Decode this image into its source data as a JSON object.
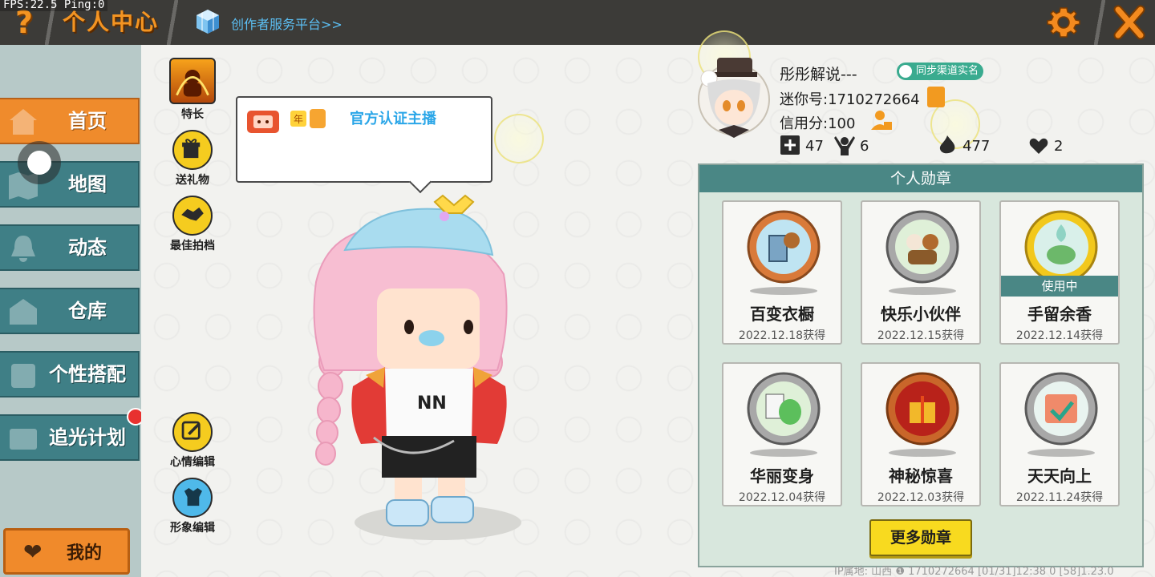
{
  "topbar": {
    "fps": "FPS:22.5  Ping:0",
    "help_label": "?",
    "title": "个人中心",
    "creator_link": "创作者服务平台>>"
  },
  "sidebar": {
    "items": [
      {
        "label": "首页",
        "icon": "home-icon",
        "active": true
      },
      {
        "label": "地图",
        "icon": "map-icon",
        "active": false
      },
      {
        "label": "动态",
        "icon": "bell-icon",
        "active": false
      },
      {
        "label": "仓库",
        "icon": "warehouse-icon",
        "active": false
      },
      {
        "label": "个性搭配",
        "icon": "outfit-icon",
        "active": false
      },
      {
        "label": "追光计划",
        "icon": "spotlight-icon",
        "active": false
      }
    ],
    "my_button": "我的"
  },
  "actions": {
    "specialty": "特长",
    "send_gift": "送礼物",
    "best_photo": "最佳拍档",
    "mood_edit": "心情编辑",
    "image_edit": "形象编辑"
  },
  "bubble": {
    "badge_text": "年",
    "verified_label": "官方认证主播"
  },
  "profile": {
    "name": "彤彤解说---",
    "sync_label": "同步渠道实名",
    "mini_id": "迷你号:1710272664",
    "credit": "信用分:100",
    "stats": {
      "bookmarks": "47",
      "followers": "6",
      "fire": "477",
      "likes": "2"
    }
  },
  "medals": {
    "header": "个人勋章",
    "in_use_label": "使用中",
    "items": [
      {
        "name": "百变衣橱",
        "date": "2022.12.18获得"
      },
      {
        "name": "快乐小伙伴",
        "date": "2022.12.15获得"
      },
      {
        "name": "手留余香",
        "date": "2022.12.14获得"
      },
      {
        "name": "华丽变身",
        "date": "2022.12.04获得"
      },
      {
        "name": "神秘惊喜",
        "date": "2022.12.03获得"
      },
      {
        "name": "天天向上",
        "date": "2022.11.24获得"
      }
    ],
    "more_label": "更多勋章"
  },
  "footer": {
    "info": "IP属地: 山西 ❶      1710272664   [01/31]12:38 0  [58]1.23.0"
  },
  "colors": {
    "accent_orange": "#f39422",
    "teal": "#4a8785",
    "nav_teal": "#3f7f86",
    "yellow_button": "#f8da1f"
  }
}
